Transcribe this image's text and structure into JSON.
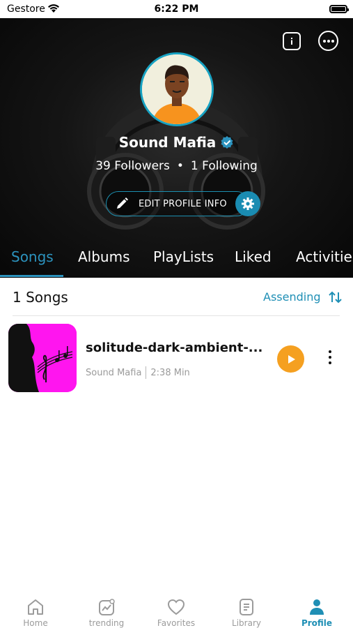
{
  "status_bar": {
    "carrier": "Gestore",
    "time": "6:22 PM"
  },
  "profile": {
    "name": "Sound Mafia",
    "followers": "39 Followers",
    "separator": "•",
    "following": "1 Following",
    "edit_label": "EDIT PROFILE INFO"
  },
  "tabs": [
    {
      "label": "Songs"
    },
    {
      "label": "Albums"
    },
    {
      "label": "PlayLists"
    },
    {
      "label": "Liked"
    },
    {
      "label": "Activities"
    }
  ],
  "list": {
    "count": "1 Songs",
    "sort_label": "Assending"
  },
  "songs": [
    {
      "title": "solitude-dark-ambient-...",
      "artist": "Sound Mafia",
      "duration": "2:38 Min"
    }
  ],
  "nav": [
    {
      "label": "Home",
      "icon": "home-icon"
    },
    {
      "label": "trending",
      "icon": "trending-icon"
    },
    {
      "label": "Favorites",
      "icon": "heart-icon"
    },
    {
      "label": "Library",
      "icon": "library-icon"
    },
    {
      "label": "Profile",
      "icon": "profile-icon"
    }
  ],
  "colors": {
    "accent": "#2c93be",
    "play": "#f5a020",
    "cover": "#ff15ef",
    "hero_bg": "#111111"
  }
}
